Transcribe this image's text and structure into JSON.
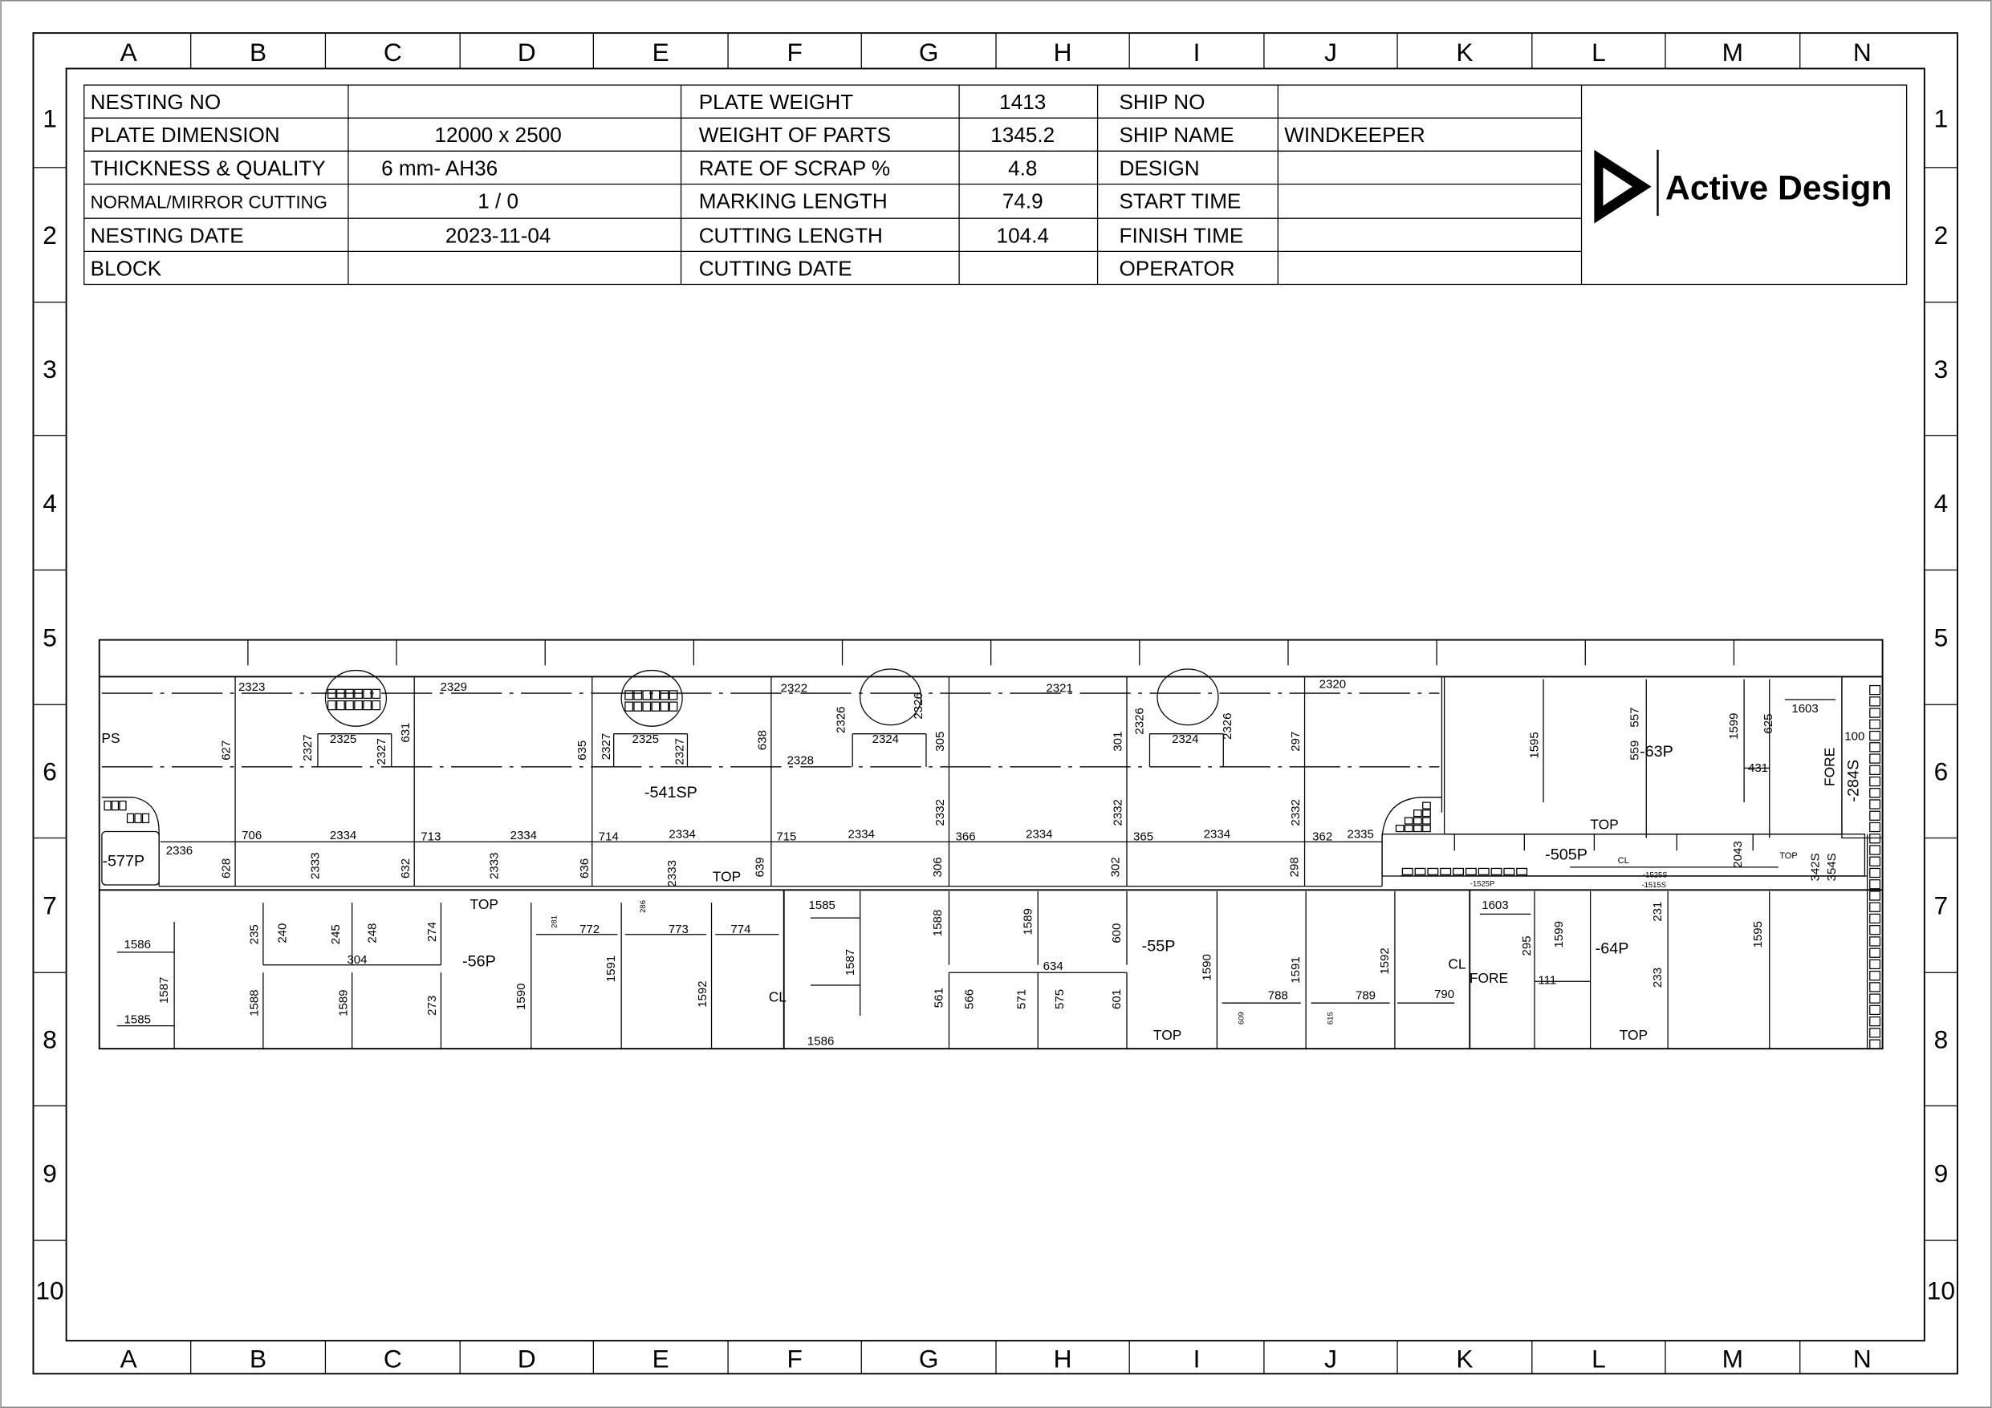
{
  "sheet": {
    "columns": [
      "A",
      "B",
      "C",
      "D",
      "E",
      "F",
      "G",
      "H",
      "I",
      "J",
      "K",
      "L",
      "M",
      "N"
    ],
    "rows": [
      "1",
      "2",
      "3",
      "4",
      "5",
      "6",
      "7",
      "8",
      "9",
      "10"
    ]
  },
  "title_block": {
    "rows": [
      {
        "label": "NESTING NO",
        "value": "",
        "label2": "PLATE WEIGHT",
        "value2": "1413",
        "label3": "SHIP NO",
        "value3": ""
      },
      {
        "label": "PLATE DIMENSION",
        "value": "12000 x 2500",
        "label2": "WEIGHT OF PARTS",
        "value2": "1345.2",
        "label3": "SHIP NAME",
        "value3": "WINDKEEPER"
      },
      {
        "label": "THICKNESS & QUALITY",
        "value": "6        mm- AH36",
        "label2": "RATE OF SCRAP %",
        "value2": "4.8",
        "label3": "DESIGN",
        "value3": ""
      },
      {
        "label": "NORMAL/MIRROR CUTTING",
        "value": "1        /        0",
        "label2": "MARKING LENGTH",
        "value2": "74.9",
        "label3": "START TIME",
        "value3": ""
      },
      {
        "label": "NESTING DATE",
        "value": "2023-11-04",
        "label2": "CUTTING LENGTH",
        "value2": "104.4",
        "label3": "FINISH TIME",
        "value3": ""
      },
      {
        "label": "BLOCK",
        "value": "",
        "label2": "CUTTING DATE",
        "value2": "",
        "label3": "OPERATOR",
        "value3": ""
      }
    ],
    "logo_text": "Active Design"
  },
  "drawing": {
    "labels": [
      "2323",
      "2325",
      "2329",
      "2325",
      "2322",
      "2324",
      "2321",
      "2324",
      "2320",
      "2328",
      "PS",
      "-541SP",
      "627",
      "2327",
      "2327",
      "631",
      "635",
      "2327",
      "2327",
      "638",
      "2326",
      "2326",
      "305",
      "301",
      "2326",
      "2326",
      "297",
      "2332",
      "2332",
      "2332",
      "706",
      "2334",
      "713",
      "2334",
      "714",
      "2334",
      "715",
      "2334",
      "366",
      "2334",
      "365",
      "2334",
      "362",
      "2335",
      "2336",
      "-577P",
      "628",
      "2333",
      "632",
      "2333",
      "636",
      "2333",
      "TOP",
      "639",
      "306",
      "302",
      "298",
      "1595",
      "557",
      "559",
      "-63P",
      "1599",
      "625",
      "1603",
      "431",
      "100",
      "FORE",
      "-284S",
      "TOP",
      "-505P",
      "CL",
      "2043",
      "TOP",
      "342S",
      "354S",
      "-1525S",
      "-1515S",
      "-1525P",
      "TOP",
      "1586",
      "1587",
      "1585",
      "235",
      "240",
      "245",
      "248",
      "274",
      "304",
      "-56P",
      "1588",
      "1589",
      "273",
      "1590",
      "772",
      "773",
      "774",
      "1591",
      "1592",
      "CL",
      "281",
      "286",
      "1585",
      "1587",
      "1586",
      "1588",
      "1589",
      "600",
      "-55P",
      "634",
      "561",
      "566",
      "571",
      "575",
      "601",
      "1590",
      "1591",
      "1592",
      "788",
      "789",
      "790",
      "CL",
      "TOP",
      "609",
      "615",
      "1603",
      "295",
      "1599",
      "FORE",
      "111",
      "-64P",
      "231",
      "233",
      "1595",
      "TOP"
    ]
  }
}
